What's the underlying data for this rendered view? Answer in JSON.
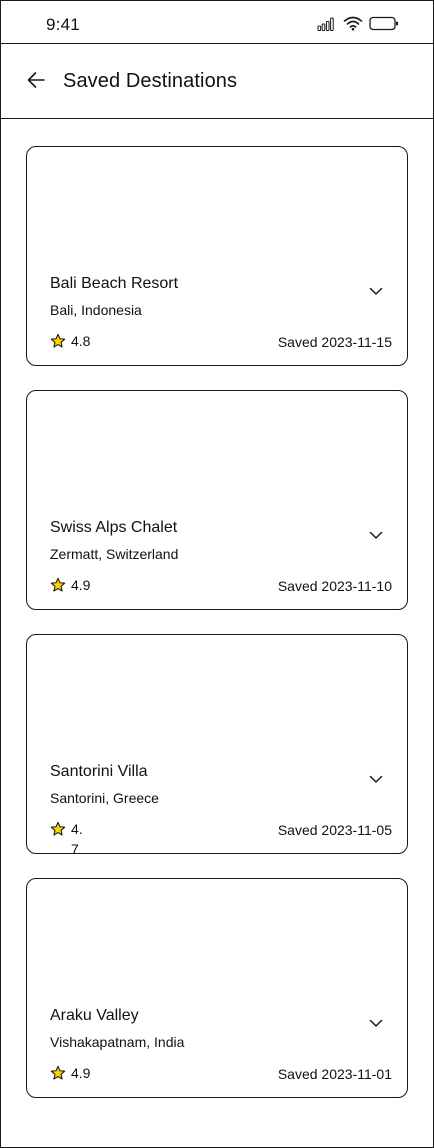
{
  "status_bar": {
    "time": "9:41",
    "icons": [
      "signal-icon",
      "wifi-icon",
      "battery-icon"
    ]
  },
  "header": {
    "back_icon": "arrow-left-icon",
    "title": "Saved Destinations"
  },
  "destinations": [
    {
      "name": "Bali Beach Resort",
      "location": "Bali, Indonesia",
      "rating": "4.8",
      "saved": "Saved 2023-11-15"
    },
    {
      "name": "Swiss Alps Chalet",
      "location": "Zermatt, Switzerland",
      "rating": "4.9",
      "saved": "Saved 2023-11-10"
    },
    {
      "name": "Santorini Villa",
      "location": "Santorini, Greece",
      "rating": "4.7",
      "saved": "Saved 2023-11-05"
    },
    {
      "name": "Araku Valley",
      "location": "Vishakapatnam, India",
      "rating": "4.9",
      "saved": "Saved 2023-11-01"
    }
  ],
  "colors": {
    "border": "#1a1a1a",
    "star_fill": "#FFD400",
    "text": "#111111"
  }
}
